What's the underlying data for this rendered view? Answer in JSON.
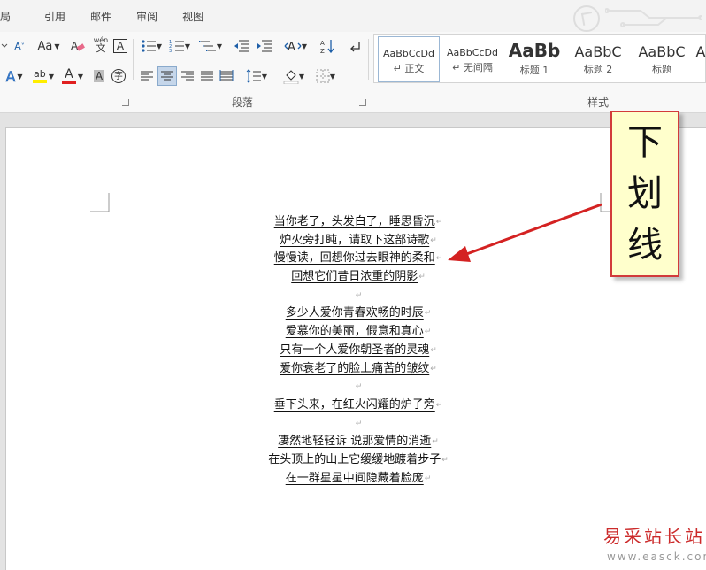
{
  "ribbon_tabs": [
    "局",
    "引用",
    "邮件",
    "审阅",
    "视图"
  ],
  "font_group": {
    "grow_font_label": "A",
    "shrink_font_label": "A",
    "change_case_label": "Aa",
    "pinyin_label": "wén",
    "char_border_label": "A",
    "text_effects_label": "A",
    "highlight_label": "ab",
    "font_color_label": "A",
    "shading_label": "A",
    "enclose_label": "字"
  },
  "paragraph_group": {
    "label": "段落"
  },
  "styles_group": {
    "label": "样式",
    "items": [
      {
        "sample": "AaBbCcDd",
        "name": "↵ 正文"
      },
      {
        "sample": "AaBbCcDd",
        "name": "↵ 无间隔"
      },
      {
        "sample": "AaBb",
        "name": "标题 1"
      },
      {
        "sample": "AaBbC",
        "name": "标题 2"
      },
      {
        "sample": "AaBbC",
        "name": "标题"
      },
      {
        "sample": "A",
        "name": ""
      }
    ]
  },
  "document": {
    "paragraph_mark": "↵",
    "lines": [
      "当你老了，头发白了，睡思昏沉",
      "炉火旁打盹，请取下这部诗歌",
      "慢慢读，回想你过去眼神的柔和",
      "回想它们昔日浓重的阴影",
      "",
      "多少人爱你青春欢畅的时辰",
      "爱慕你的美丽，假意和真心",
      "只有一个人爱你朝圣者的灵魂",
      "爱你衰老了的脸上痛苦的皱纹",
      "",
      "垂下头来，在红火闪耀的炉子旁",
      "",
      "凄然地轻轻诉 说那爱情的消逝",
      "在头顶上的山上它缓缓地踱着步子",
      "在一群星星中间隐藏着脸庞"
    ]
  },
  "callout": {
    "chars": [
      "下",
      "划",
      "线"
    ]
  },
  "watermark": {
    "title": "易采站长站",
    "url": "www.easck.com"
  },
  "colors": {
    "callout_border": "#d23b3b",
    "arrow": "#d42222",
    "callout_bg": "#ffffcc",
    "watermark": "#cc2b2b"
  }
}
